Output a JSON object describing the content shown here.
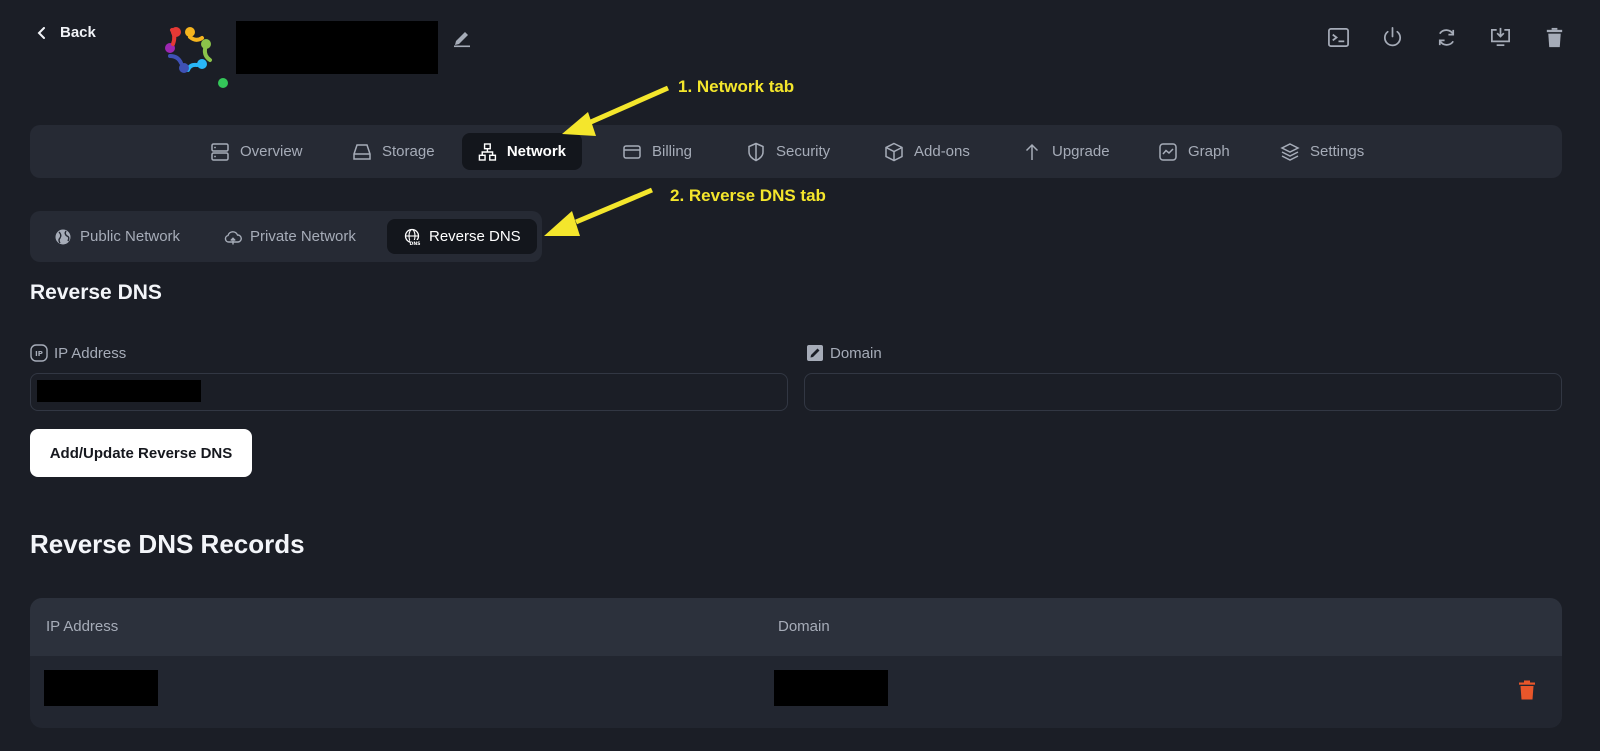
{
  "header": {
    "back_label": "Back",
    "icons": [
      "console-icon",
      "power-icon",
      "reboot-icon",
      "snapshot-download-icon",
      "delete-trash-icon"
    ]
  },
  "main_tabs": [
    {
      "label": "Overview",
      "icon": "server-icon"
    },
    {
      "label": "Storage",
      "icon": "drive-icon"
    },
    {
      "label": "Network",
      "icon": "network-icon",
      "active": true
    },
    {
      "label": "Billing",
      "icon": "card-icon"
    },
    {
      "label": "Security",
      "icon": "shield-icon"
    },
    {
      "label": "Add-ons",
      "icon": "box-icon"
    },
    {
      "label": "Upgrade",
      "icon": "arrow-up-icon"
    },
    {
      "label": "Graph",
      "icon": "graph-icon"
    },
    {
      "label": "Settings",
      "icon": "layers-icon"
    }
  ],
  "sub_tabs": [
    {
      "label": "Public Network",
      "icon": "globe-icon"
    },
    {
      "label": "Private Network",
      "icon": "cloud-icon"
    },
    {
      "label": "Reverse DNS",
      "icon": "dns-globe-icon",
      "active": true
    }
  ],
  "annotations": {
    "network_tab": "1. Network tab",
    "reverse_dns_tab": "2. Reverse DNS tab"
  },
  "form": {
    "title": "Reverse DNS",
    "ip_label": "IP Address",
    "domain_label": "Domain",
    "ip_value": "",
    "domain_value": "",
    "submit_label": "Add/Update Reverse DNS"
  },
  "records": {
    "title": "Reverse DNS Records",
    "columns": [
      "IP Address",
      "Domain"
    ]
  },
  "colors": {
    "background": "#1b1e26",
    "panel": "#262a34",
    "active_tab": "#13161c",
    "annotation": "#f4e62c",
    "delete": "#e8562a",
    "online": "#34c759"
  }
}
